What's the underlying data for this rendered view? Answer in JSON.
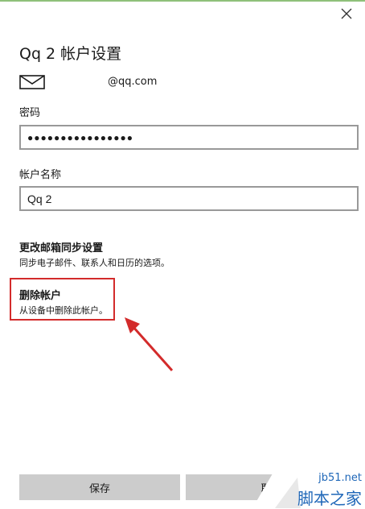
{
  "window": {
    "title": "Qq 2 帐户设置",
    "accent_color": "#8fc07a",
    "close_icon": "close-icon"
  },
  "account": {
    "email": "@qq.com",
    "mail_icon": "mail-icon"
  },
  "password": {
    "label": "密码",
    "value": "●●●●●●●●●●●●●●●●"
  },
  "account_name": {
    "label": "帐户名称",
    "value": "Qq 2"
  },
  "sync_settings": {
    "title": "更改邮箱同步设置",
    "description": "同步电子邮件、联系人和日历的选项。"
  },
  "delete_account": {
    "title": "删除帐户",
    "description": "从设备中删除此帐户。",
    "highlight_color": "#d32b2b"
  },
  "buttons": {
    "save": "保存",
    "cancel": "取"
  },
  "watermark": {
    "site": "jb51.net",
    "name": "脚本之家"
  }
}
